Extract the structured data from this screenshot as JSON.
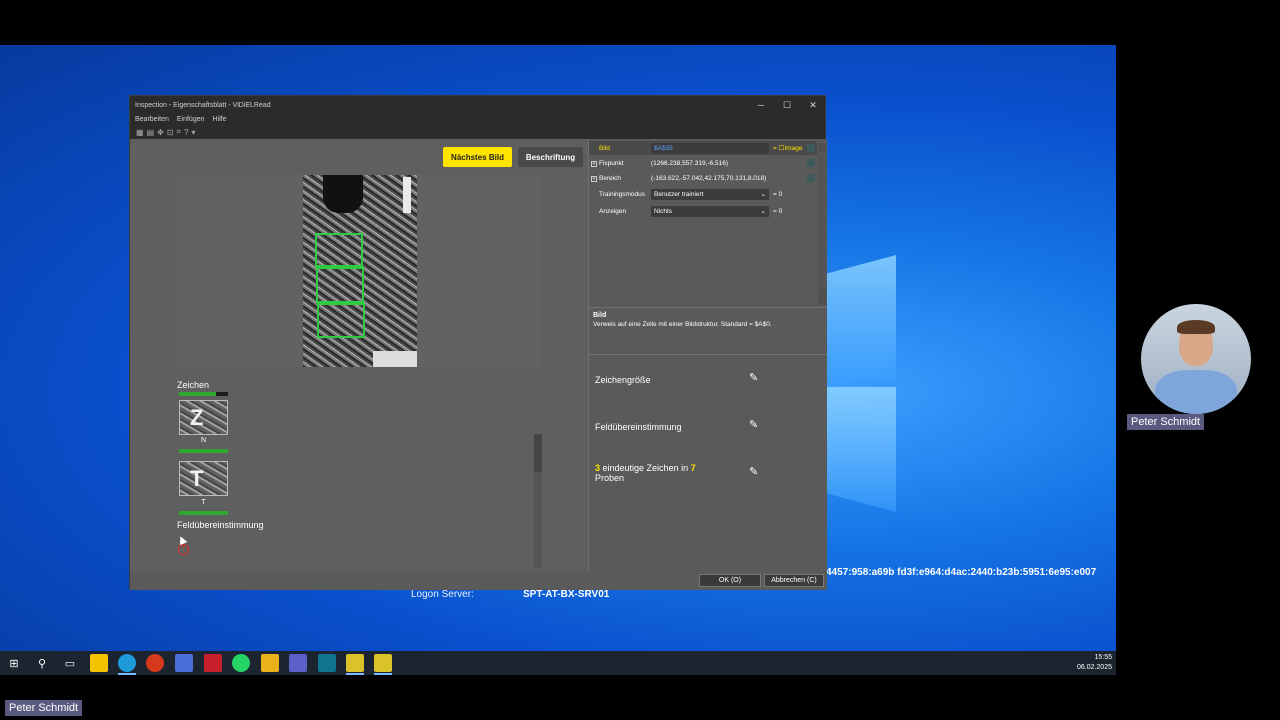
{
  "window": {
    "title": "Inspection - Eigenschaftsblatt - ViDiELRead",
    "minimize": "─",
    "maximize": "☐",
    "close": "✕"
  },
  "menu": {
    "items": [
      "Bearbeiten",
      "Einfügen",
      "Hilfe"
    ]
  },
  "buttons": {
    "next_image": "Nächstes Bild",
    "labeling": "Beschriftung",
    "ok": "OK (O)",
    "cancel": "Abbrechen (C)"
  },
  "left_panel": {
    "section_chars": "Zeichen",
    "chars": [
      {
        "glyph": "Z",
        "label": "N"
      },
      {
        "glyph": "T",
        "label": "T"
      }
    ],
    "section_field": "Feldübereinstimmung",
    "progress": [
      0.75,
      1.0,
      1.0
    ]
  },
  "properties": {
    "rows": [
      {
        "name": "Bild",
        "value": "$A$35",
        "suffix": "= ☐Image"
      },
      {
        "name": "Fixpunkt",
        "value": "(1266.238,557.319,-6.516)",
        "suffix": ""
      },
      {
        "name": "Bereich",
        "value": "(-163.622,-57.042,42.175,70.131,8.018)",
        "suffix": ""
      },
      {
        "name": "Trainingsmodus",
        "value": "Benutzer trainiert",
        "suffix": "= 0"
      },
      {
        "name": "Anzeigen",
        "value": "Nichts",
        "suffix": "= 0"
      }
    ]
  },
  "description": {
    "title": "Bild",
    "text": "Verweis auf eine Zelle mit einer Bildstruktur. Standard = $A$0."
  },
  "features": {
    "char_size": "Zeichengröße",
    "field_match": "Feldübereinstimmung",
    "unique_count": "3",
    "unique_text_a": " eindeutige Zeichen in ",
    "sample_count": "7",
    "unique_text_b": "Proben"
  },
  "desktop": {
    "ipv6_text": "4457:958:a69b fd3f:e964:d4ac:2440:b23b:5951:6e95:e007",
    "logon_label": "Logon Server:",
    "logon_value": "SPT-AT-BX-SRV01"
  },
  "taskbar": {
    "time": "15:55",
    "date": "06.02.2025"
  },
  "presenter": {
    "name_side": "Peter Schmidt",
    "name_bottom": "Peter Schmidt"
  },
  "colors": {
    "accent_yellow": "#ffe400",
    "box_green": "#2ecc40",
    "error_red": "#e03030"
  }
}
